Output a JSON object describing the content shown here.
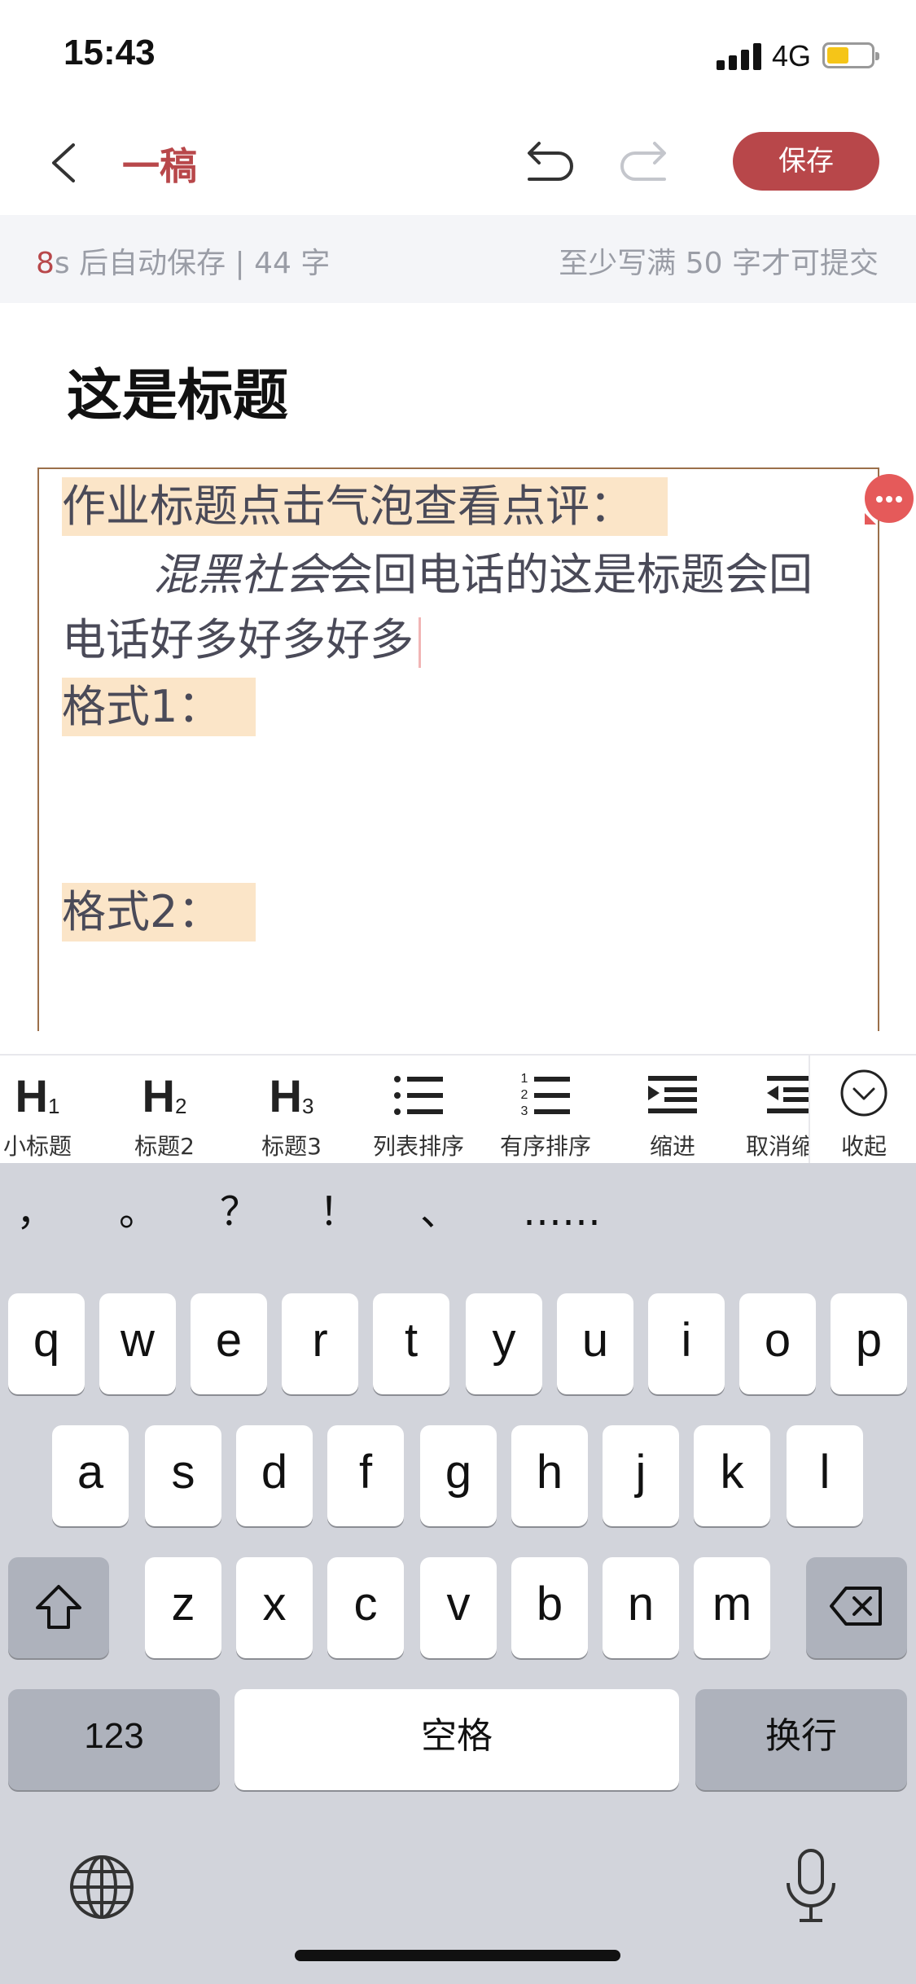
{
  "status": {
    "time": "15:43",
    "network": "4G"
  },
  "nav": {
    "title": "一稿",
    "save_label": "保存"
  },
  "info": {
    "autosave_seconds": "8",
    "autosave_rest": "s 后自动保存 | 44 字",
    "hint": "至少写满 50 字才可提交"
  },
  "article": {
    "title": "这是标题",
    "line1": "作业标题点击气泡查看点评：",
    "line2_italic": "混黑社会",
    "line2_rest": "会回电话的这是标题会回",
    "line3": "电话好多好多好多",
    "format1": "格式1：",
    "format2": "格式2："
  },
  "toolbar": [
    {
      "glyph": "H",
      "sub": "1",
      "label": "小标题"
    },
    {
      "glyph": "H",
      "sub": "2",
      "label": "标题2"
    },
    {
      "glyph": "H",
      "sub": "3",
      "label": "标题3"
    },
    {
      "label": "列表排序"
    },
    {
      "label": "有序排序"
    },
    {
      "label": "缩进"
    },
    {
      "label": "取消缩进"
    },
    {
      "label": "收起"
    }
  ],
  "ordered_list_icon_numbers": [
    "1",
    "2",
    "3"
  ],
  "keyboard": {
    "punctuation": [
      "，",
      "。",
      "？",
      "！",
      "、",
      "……"
    ],
    "row1": [
      "q",
      "w",
      "e",
      "r",
      "t",
      "y",
      "u",
      "i",
      "o",
      "p"
    ],
    "row2": [
      "a",
      "s",
      "d",
      "f",
      "g",
      "h",
      "j",
      "k",
      "l"
    ],
    "row3": [
      "z",
      "x",
      "c",
      "v",
      "b",
      "n",
      "m"
    ],
    "numbers_label": "123",
    "space_label": "空格",
    "return_label": "换行"
  },
  "colors": {
    "accent": "#b8474a",
    "highlight": "#fbe5c8",
    "editor_border": "#9b6f4a",
    "comment_bubble": "#e55a5a"
  }
}
